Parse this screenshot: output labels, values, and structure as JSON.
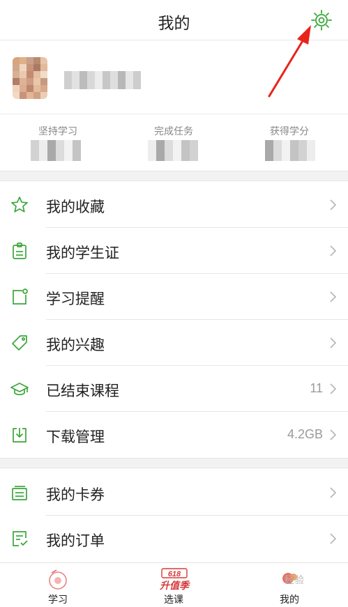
{
  "header": {
    "title": "我的",
    "settings_icon": "gear-icon"
  },
  "stats": [
    {
      "label": "坚持学习"
    },
    {
      "label": "完成任务"
    },
    {
      "label": "获得学分"
    }
  ],
  "menu_group_1": [
    {
      "label": "我的收藏",
      "value": "",
      "icon": "star-icon"
    },
    {
      "label": "我的学生证",
      "value": "",
      "icon": "student-card-icon"
    },
    {
      "label": "学习提醒",
      "value": "",
      "icon": "reminder-icon"
    },
    {
      "label": "我的兴趣",
      "value": "",
      "icon": "tag-icon"
    },
    {
      "label": "已结束课程",
      "value": "11",
      "icon": "graduation-cap-icon"
    },
    {
      "label": "下载管理",
      "value": "4.2GB",
      "icon": "download-icon"
    }
  ],
  "menu_group_2": [
    {
      "label": "我的卡券",
      "value": "",
      "icon": "coupon-icon"
    },
    {
      "label": "我的订单",
      "value": "",
      "icon": "order-icon"
    }
  ],
  "tabbar": {
    "tabs": [
      {
        "label": "学习",
        "icon": "study-icon"
      },
      {
        "label": "选课",
        "icon": "promo-618-icon"
      },
      {
        "label": "我的",
        "icon": "profile-icon",
        "active": true
      }
    ],
    "badge_618": {
      "line1": "618",
      "line2": "升值季"
    }
  },
  "watermark": "经验",
  "colors": {
    "accent": "#3aa63a",
    "promo": "#d6393a",
    "arrow": "#e8231a"
  }
}
